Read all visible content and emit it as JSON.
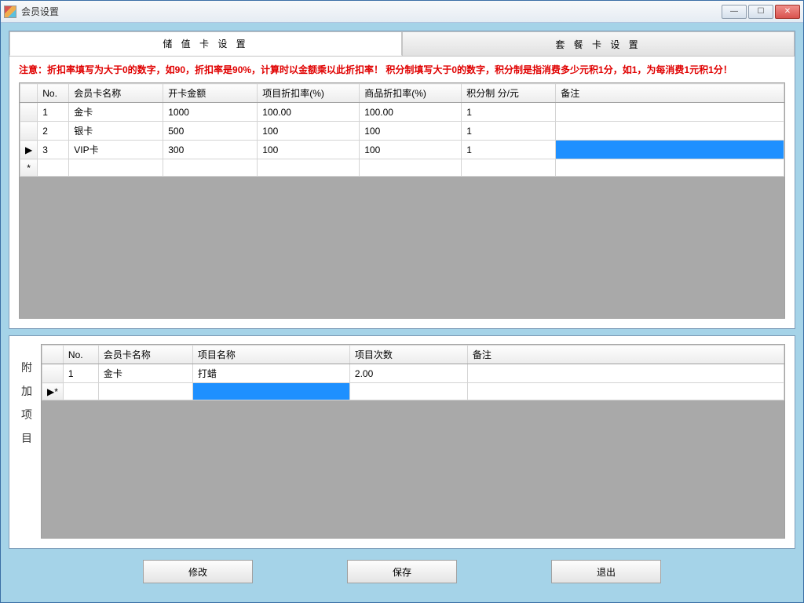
{
  "window": {
    "title": "会员设置"
  },
  "tabs": {
    "stored_value": "储 值 卡 设 置",
    "package": "套 餐 卡 设 置"
  },
  "notice": "注意：折扣率填写为大于0的数字，如90，折扣率是90%，计算时以金额乘以此折扣率！  积分制填写大于0的数字，积分制是指消费多少元积1分，如1，为每消费1元积1分！",
  "grid1": {
    "headers": {
      "no": "No.",
      "name": "会员卡名称",
      "open_amount": "开卡金额",
      "item_discount": "项目折扣率(%)",
      "goods_discount": "商品折扣率(%)",
      "points": "积分制 分/元",
      "remark": "备注"
    },
    "rows": [
      {
        "no": "1",
        "name": "金卡",
        "open_amount": "1000",
        "item_discount": "100.00",
        "goods_discount": "100.00",
        "points": "1",
        "remark": ""
      },
      {
        "no": "2",
        "name": "银卡",
        "open_amount": "500",
        "item_discount": "100",
        "goods_discount": "100",
        "points": "1",
        "remark": ""
      },
      {
        "no": "3",
        "name": "VIP卡",
        "open_amount": "300",
        "item_discount": "100",
        "goods_discount": "100",
        "points": "1",
        "remark": ""
      }
    ],
    "new_row_marker": "*",
    "current_row_marker": "▶"
  },
  "sidebar_label": {
    "c1": "附",
    "c2": "加",
    "c3": "项",
    "c4": "目"
  },
  "grid2": {
    "headers": {
      "no": "No.",
      "name": "会员卡名称",
      "item_name": "项目名称",
      "item_count": "项目次数",
      "remark": "备注"
    },
    "rows": [
      {
        "no": "1",
        "name": "金卡",
        "item_name": "打蜡",
        "item_count": "2.00",
        "remark": ""
      }
    ],
    "new_row_marker": "▶*"
  },
  "buttons": {
    "modify": "修改",
    "save": "保存",
    "exit": "退出"
  }
}
